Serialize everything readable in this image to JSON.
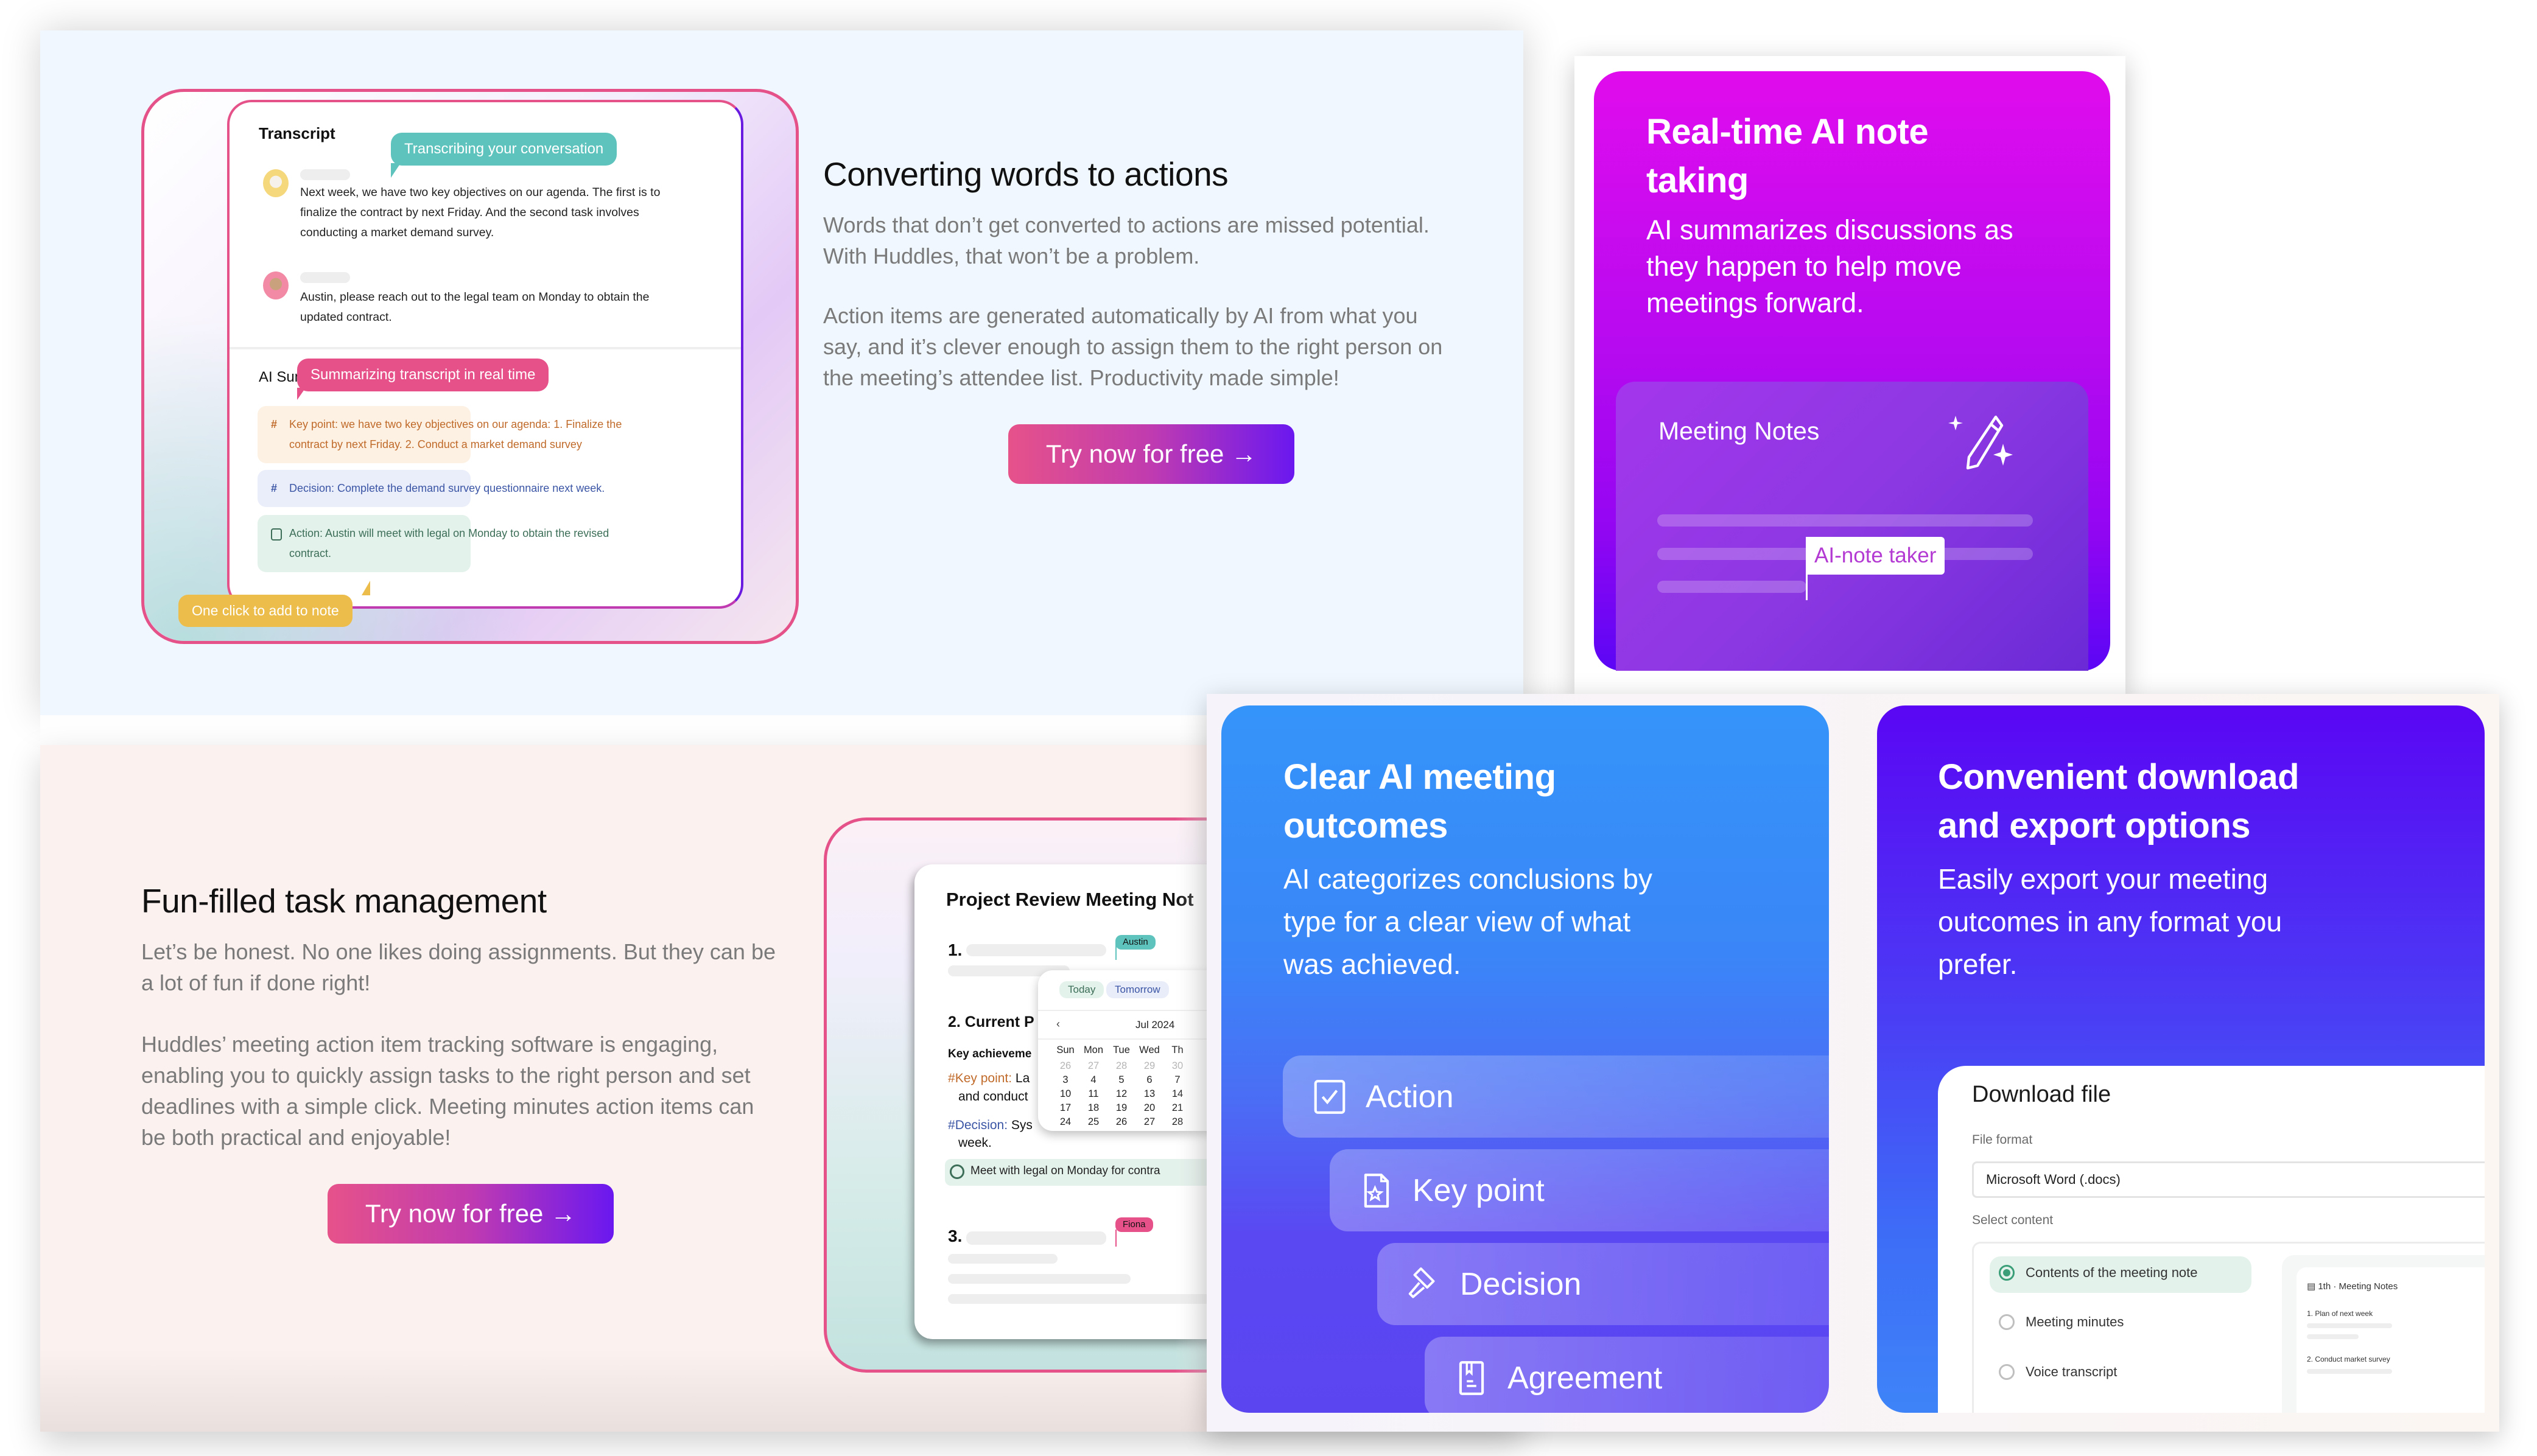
{
  "transcript_demo": {
    "transcript_heading": "Transcript",
    "bubble_transcribing": "Transcribing your conversation",
    "messages": [
      {
        "text_lines": [
          "Next week, we have two key objectives on our agenda. The first is to",
          "finalize the contract by next Friday. And the second task involves",
          "conducting a market demand survey."
        ]
      },
      {
        "text_lines": [
          "Austin, please reach out to the legal team on Monday to obtain the",
          "updated contract."
        ]
      }
    ],
    "summary_heading": "AI Summary",
    "bubble_summarizing": "Summarizing transcript in real time",
    "summary_items": [
      {
        "type": "key-point",
        "symbol": "#",
        "lines": [
          "Key point: we have two key objectives on our agenda: 1. Finalize the",
          "contract by next Friday. 2. Conduct a market demand survey"
        ],
        "color": "#c06a2a",
        "bg": "#fdf1e3"
      },
      {
        "type": "decision",
        "symbol": "#",
        "lines": [
          "Decision: Complete the demand survey questionnaire next week."
        ],
        "color": "#3b55a5",
        "bg": "#eaeefa"
      },
      {
        "type": "action",
        "symbol": "checkbox",
        "lines": [
          "Action: Austin will meet with legal on Monday to obtain the revised",
          "contract."
        ],
        "color": "#3c6e58",
        "bg": "#e4f2ec"
      }
    ],
    "bubble_add_note": "One click to add to note"
  },
  "converting_section": {
    "heading": "Converting words to actions",
    "paragraph1_lines": [
      "Words that don’t get converted to actions are missed potential.",
      "With Huddles, that won’t be a problem."
    ],
    "paragraph2_lines": [
      "Action items are generated automatically by AI from what you",
      "say, and it’s clever enough to assign them to the right person on",
      "the meeting’s attendee list. Productivity made simple!"
    ],
    "cta_label": "Try now for free →"
  },
  "task_section": {
    "heading": "Fun-filled task management",
    "paragraph1_lines": [
      "Let’s be honest. No one likes doing assignments. But they can be",
      "a lot of fun if done right!"
    ],
    "paragraph2_lines": [
      "Huddles’ meeting action item tracking software is engaging,",
      "enabling you to quickly assign tasks to the right person and set",
      "deadlines with a simple click. Meeting minutes action items can",
      "be both practical and enjoyable!"
    ],
    "cta_label": "Try now for free →"
  },
  "project_demo": {
    "title": "Project Review Meeting Not",
    "item1_num": "1.",
    "item1_assignee": "Austin",
    "item2_heading": "2. Current P",
    "key_achievements": "Key achieveme",
    "key_point_label": "Key point:",
    "key_point_text": " La",
    "key_point_cont": "and conduct",
    "decision_label": "Decision:",
    "decision_text": " Sys",
    "decision_cont": "week.",
    "task_text": "Meet with legal on Monday for contra",
    "item3_num": "3.",
    "item3_assignee": "Fiona",
    "calendar": {
      "chip_today": "Today",
      "chip_tomorrow": "Tomorrow",
      "month_label": "Jul 2024",
      "weekdays": [
        "Sun",
        "Mon",
        "Tue",
        "Wed",
        "Th"
      ],
      "weeks": [
        [
          {
            "d": "26",
            "m": true
          },
          {
            "d": "27",
            "m": true
          },
          {
            "d": "28",
            "m": true
          },
          {
            "d": "29",
            "m": true
          },
          {
            "d": "30",
            "m": true
          }
        ],
        [
          {
            "d": "3"
          },
          {
            "d": "4"
          },
          {
            "d": "5"
          },
          {
            "d": "6"
          },
          {
            "d": "7"
          }
        ],
        [
          {
            "d": "10"
          },
          {
            "d": "11"
          },
          {
            "d": "12"
          },
          {
            "d": "13"
          },
          {
            "d": "14"
          }
        ],
        [
          {
            "d": "17"
          },
          {
            "d": "18"
          },
          {
            "d": "19"
          },
          {
            "d": "20"
          },
          {
            "d": "21"
          }
        ],
        [
          {
            "d": "24"
          },
          {
            "d": "25"
          },
          {
            "d": "26"
          },
          {
            "d": "27"
          },
          {
            "d": "28"
          }
        ]
      ]
    }
  },
  "realtime_card": {
    "title_lines": [
      "Real-time AI note",
      "taking"
    ],
    "description_lines": [
      "AI summarizes discussions as",
      "they happen to help move",
      "meetings forward."
    ],
    "notes_title": "Meeting Notes",
    "flag_label": "AI-note taker",
    "colors": {
      "top": "#e00ced",
      "bottom": "#5b06f5"
    }
  },
  "outcomes_card": {
    "title_lines": [
      "Clear AI meeting",
      "outcomes"
    ],
    "description_lines": [
      "AI categorizes conclusions by",
      "type for a clear view of what",
      "was achieved."
    ],
    "categories": [
      {
        "label": "Action",
        "icon": "checkbox-icon"
      },
      {
        "label": "Key point",
        "icon": "document-star-icon"
      },
      {
        "label": "Decision",
        "icon": "gavel-icon"
      },
      {
        "label": "Agreement",
        "icon": "bookmark-document-icon"
      }
    ]
  },
  "export_card": {
    "title_lines": [
      "Convenient download",
      "and export options"
    ],
    "description_lines": [
      "Easily export your meeting",
      "outcomes in any format you",
      "prefer."
    ],
    "modal": {
      "title": "Download file",
      "file_format_label": "File format",
      "file_format_value": "Microsoft Word (.docs)",
      "select_content_label": "Select content",
      "options": [
        {
          "label": "Contents of the meeting note",
          "selected": true
        },
        {
          "label": "Meeting minutes",
          "selected": false
        },
        {
          "label": "Voice transcript",
          "selected": false
        }
      ],
      "preview": {
        "title": "1th · Meeting Notes",
        "item1": "1. Plan of next week",
        "item2": "2. Conduct market survey"
      }
    }
  }
}
